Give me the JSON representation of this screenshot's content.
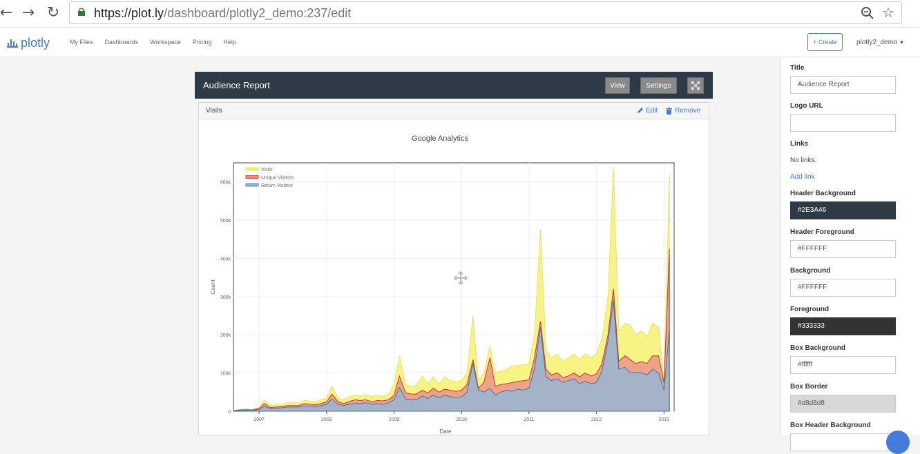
{
  "browser": {
    "url_host": "https://plot.ly",
    "url_path": "/dashboard/plotly2_demo:237/edit"
  },
  "nav": {
    "logo_text": "plotly",
    "links": [
      "My Files",
      "Dashboards",
      "Workspace",
      "Pricing",
      "Help"
    ],
    "create_label": "+ Create",
    "user": "plotly2_demo"
  },
  "dashboard": {
    "title": "Audience Report",
    "view_label": "View",
    "settings_label": "Settings"
  },
  "box": {
    "title": "Visits",
    "edit_label": "Edit",
    "remove_label": "Remove"
  },
  "sidebar": {
    "title_label": "Title",
    "title_value": "Audience Report",
    "logo_label": "Logo URL",
    "logo_value": "",
    "links_label": "Links",
    "no_links": "No links.",
    "add_link": "Add link",
    "header_bg_label": "Header Background",
    "header_bg_value": "#2E3A46",
    "header_fg_label": "Header Foreground",
    "header_fg_value": "#FFFFFF",
    "bg_label": "Background",
    "bg_value": "#FFFFFF",
    "fg_label": "Foreground",
    "fg_value": "#333333",
    "box_bg_label": "Box Background",
    "box_bg_value": "#ffffff",
    "box_border_label": "Box Border",
    "box_border_value": "#d8d8d8",
    "box_header_bg_label": "Box Header Background"
  },
  "colors": {
    "header_bg": "#2E3A46",
    "accent": "#447bdc",
    "visits": "#f5f05a",
    "unique": "#e8888a",
    "return": "#8cb8dd"
  },
  "chart_data": {
    "type": "area",
    "title": "Google Analytics",
    "xlabel": "Date",
    "ylabel": "Count",
    "ylim": [
      0,
      650000
    ],
    "xlim": [
      2006.62,
      2013.15
    ],
    "yticks": [
      "0",
      "100k",
      "200k",
      "300k",
      "400k",
      "500k",
      "600k"
    ],
    "xticks": [
      "2007",
      "2008",
      "2009",
      "2010",
      "2011",
      "2012",
      "2013"
    ],
    "legend_position": "top-left",
    "series": [
      {
        "name": "Visits",
        "color": "#f5f05a",
        "line": "#e8e26a"
      },
      {
        "name": "Unique Visitors",
        "color": "#e8888a",
        "line": "#c0392b"
      },
      {
        "name": "Return Visitors",
        "color": "#8cb8dd",
        "line": "#4a6fa5"
      }
    ],
    "x": [
      2006.62,
      2006.7,
      2006.8,
      2006.9,
      2007.0,
      2007.08,
      2007.17,
      2007.25,
      2007.33,
      2007.42,
      2007.5,
      2007.58,
      2007.67,
      2007.75,
      2007.83,
      2007.92,
      2008.0,
      2008.08,
      2008.17,
      2008.25,
      2008.33,
      2008.42,
      2008.5,
      2008.58,
      2008.67,
      2008.75,
      2008.83,
      2008.92,
      2009.0,
      2009.08,
      2009.17,
      2009.25,
      2009.33,
      2009.42,
      2009.5,
      2009.58,
      2009.67,
      2009.75,
      2009.83,
      2009.92,
      2010.0,
      2010.08,
      2010.17,
      2010.25,
      2010.33,
      2010.42,
      2010.5,
      2010.58,
      2010.67,
      2010.75,
      2010.83,
      2010.92,
      2011.0,
      2011.08,
      2011.17,
      2011.25,
      2011.33,
      2011.42,
      2011.5,
      2011.58,
      2011.67,
      2011.75,
      2011.83,
      2011.92,
      2012.0,
      2012.08,
      2012.17,
      2012.25,
      2012.33,
      2012.42,
      2012.5,
      2012.58,
      2012.67,
      2012.75,
      2012.83,
      2012.92,
      2013.0,
      2013.08
    ],
    "visits": [
      2000,
      5000,
      6000,
      5000,
      10000,
      30000,
      15000,
      17000,
      18000,
      22000,
      22000,
      22000,
      28000,
      27000,
      25000,
      30000,
      35000,
      65000,
      35000,
      30000,
      38000,
      42000,
      40000,
      43000,
      38000,
      42000,
      38000,
      45000,
      70000,
      145000,
      70000,
      65000,
      68000,
      92000,
      73000,
      90000,
      70000,
      90000,
      80000,
      78000,
      80000,
      100000,
      250000,
      80000,
      100000,
      170000,
      100000,
      105000,
      110000,
      118000,
      120000,
      122000,
      125000,
      200000,
      475000,
      160000,
      140000,
      150000,
      130000,
      140000,
      150000,
      135000,
      150000,
      140000,
      150000,
      190000,
      300000,
      640000,
      210000,
      230000,
      225000,
      200000,
      210000,
      195000,
      230000,
      220000,
      80000,
      620000
    ],
    "unique": [
      1500,
      3000,
      4000,
      3500,
      7000,
      20000,
      10000,
      11000,
      12000,
      15000,
      15000,
      15000,
      20000,
      18000,
      17000,
      20000,
      25000,
      45000,
      25000,
      20000,
      25000,
      30000,
      28000,
      30000,
      25000,
      28000,
      27000,
      30000,
      42000,
      92000,
      48000,
      45000,
      45000,
      55000,
      48000,
      60000,
      50000,
      58000,
      55000,
      52000,
      55000,
      70000,
      135000,
      60000,
      75000,
      140000,
      65000,
      70000,
      72000,
      75000,
      78000,
      80000,
      82000,
      140000,
      235000,
      110000,
      95000,
      100000,
      88000,
      92000,
      100000,
      90000,
      100000,
      92000,
      98000,
      125000,
      200000,
      320000,
      130000,
      145000,
      135000,
      125000,
      130000,
      125000,
      145000,
      145000,
      75000,
      425000
    ],
    "return": [
      1000,
      2000,
      3000,
      2500,
      5000,
      13000,
      7000,
      8000,
      9000,
      11000,
      11000,
      11000,
      14000,
      13000,
      12000,
      15000,
      18000,
      32000,
      18000,
      15000,
      18000,
      20000,
      20000,
      22000,
      18000,
      20000,
      18000,
      22000,
      30000,
      62000,
      32000,
      30000,
      30000,
      40000,
      33000,
      42000,
      35000,
      42000,
      38000,
      36000,
      38000,
      50000,
      125000,
      55000,
      50000,
      60000,
      42000,
      50000,
      55000,
      52000,
      58000,
      55000,
      60000,
      110000,
      220000,
      90000,
      80000,
      85000,
      75000,
      80000,
      85000,
      72000,
      78000,
      72000,
      75000,
      105000,
      185000,
      290000,
      110000,
      115000,
      100000,
      102000,
      100000,
      95000,
      110000,
      100000,
      55000,
      210000
    ]
  }
}
